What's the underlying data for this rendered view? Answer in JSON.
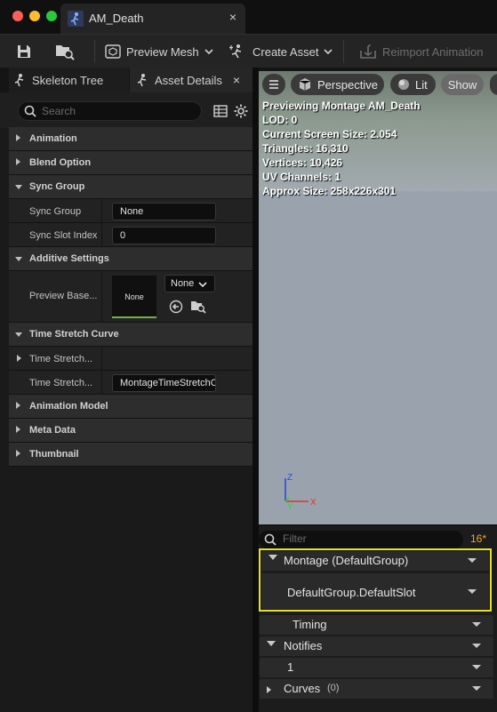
{
  "window": {
    "tab_title": "AM_Death",
    "close_glyph": "×",
    "traffic_lights": [
      "#ff5f57",
      "#febc2e",
      "#28c840"
    ]
  },
  "toolbar": {
    "preview_mesh": "Preview Mesh",
    "create_asset": "Create Asset",
    "reimport": "Reimport Animation"
  },
  "left_panel": {
    "tabs": [
      {
        "label": "Skeleton Tree"
      },
      {
        "label": "Asset Details",
        "close": "×"
      }
    ],
    "search_placeholder": "Search",
    "rows": [
      {
        "kind": "category",
        "label": "Animation",
        "expanded": false
      },
      {
        "kind": "category",
        "label": "Blend Option",
        "expanded": false
      },
      {
        "kind": "category",
        "label": "Sync Group",
        "expanded": true
      },
      {
        "kind": "property",
        "label": "Sync Group",
        "value": "None"
      },
      {
        "kind": "property",
        "label": "Sync Slot Index",
        "value": "0"
      },
      {
        "kind": "category",
        "label": "Additive Settings",
        "expanded": true
      },
      {
        "kind": "property",
        "label": "Preview Base...",
        "thumb": "None",
        "combo": "None"
      },
      {
        "kind": "category",
        "label": "Time Stretch Curve",
        "expanded": true
      },
      {
        "kind": "property",
        "label": "Time Stretch...",
        "value": ""
      },
      {
        "kind": "property",
        "label": "Time Stretch...",
        "value": "MontageTimeStretchCurve"
      },
      {
        "kind": "category",
        "label": "Animation Model",
        "expanded": false
      },
      {
        "kind": "category",
        "label": "Meta Data",
        "expanded": false
      },
      {
        "kind": "category",
        "label": "Thumbnail",
        "expanded": false
      }
    ]
  },
  "viewport": {
    "buttons": {
      "perspective": "Perspective",
      "lit": "Lit",
      "show": "Show"
    },
    "info_lines": [
      "Previewing Montage AM_Death",
      "LOD: 0",
      "Current Screen Size: 2.054",
      "Triangles: 16,310",
      "Vertices: 10,426",
      "UV Channels: 1",
      "Approx Size: 258x226x301"
    ],
    "axis": {
      "z": "Z",
      "x": "X",
      "y": "Y"
    }
  },
  "timeline": {
    "filter_placeholder": "Filter",
    "count": "16*",
    "montage_header": "Montage (DefaultGroup)",
    "slot": "DefaultGroup.DefaultSlot",
    "timing": "Timing",
    "notifies": "Notifies",
    "notify_track": "1",
    "curves": "Curves",
    "curves_count": "(0)"
  },
  "colors": {
    "highlight": "#e8e02a",
    "accent": "#f5a623"
  }
}
